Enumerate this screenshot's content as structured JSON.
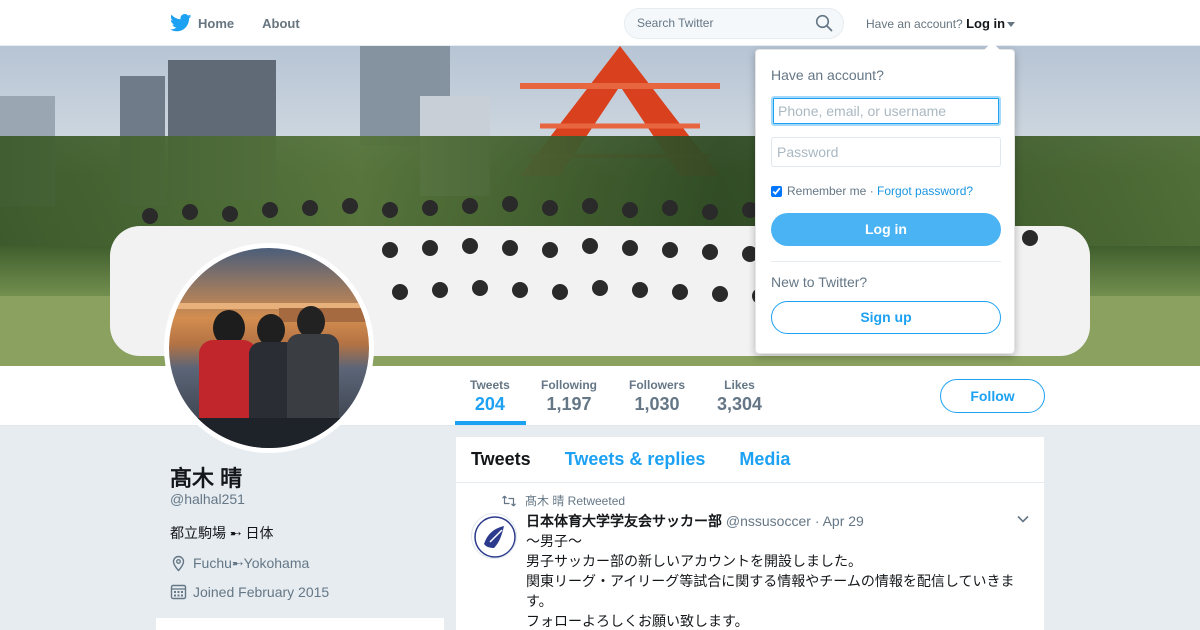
{
  "nav": {
    "home_label": "Home",
    "about_label": "About",
    "search_placeholder": "Search Twitter",
    "have_account_text": "Have an account?",
    "login_label": "Log in"
  },
  "profile": {
    "name": "髙木 晴",
    "handle": "@halhal251",
    "bio": "都立駒場 ➸ 日体",
    "location": "Fuchu➸Yokohama",
    "joined": "Joined February 2015"
  },
  "stats": [
    {
      "label": "Tweets",
      "value": "204",
      "active": true
    },
    {
      "label": "Following",
      "value": "1,197"
    },
    {
      "label": "Followers",
      "value": "1,030"
    },
    {
      "label": "Likes",
      "value": "3,304"
    }
  ],
  "follow_label": "Follow",
  "timeline": {
    "tabs": [
      "Tweets",
      "Tweets & replies",
      "Media"
    ],
    "tweet": {
      "retweet_by": "髙木 晴 Retweeted",
      "author_name": "日本体育大学学友会サッカー部",
      "author_handle": "@nssusoccer",
      "date": "· Apr 29",
      "lines": [
        "〜男子〜",
        "男子サッカー部の新しいアカウントを開設しました。",
        "関東リーグ・アイリーグ等試合に関する情報やチームの情報を配信していきます。",
        "フォローよろしくお願い致します。"
      ]
    }
  },
  "login_dropdown": {
    "title": "Have an account?",
    "username_placeholder": "Phone, email, or username",
    "password_placeholder": "Password",
    "remember_label": "Remember me",
    "forgot_label": "Forgot password?",
    "login_button": "Log in",
    "new_text": "New to Twitter?",
    "signup_button": "Sign up"
  },
  "colors": {
    "accent": "#1da1f2",
    "login_button": "#4ab3f4",
    "background": "#e6ecf0"
  }
}
